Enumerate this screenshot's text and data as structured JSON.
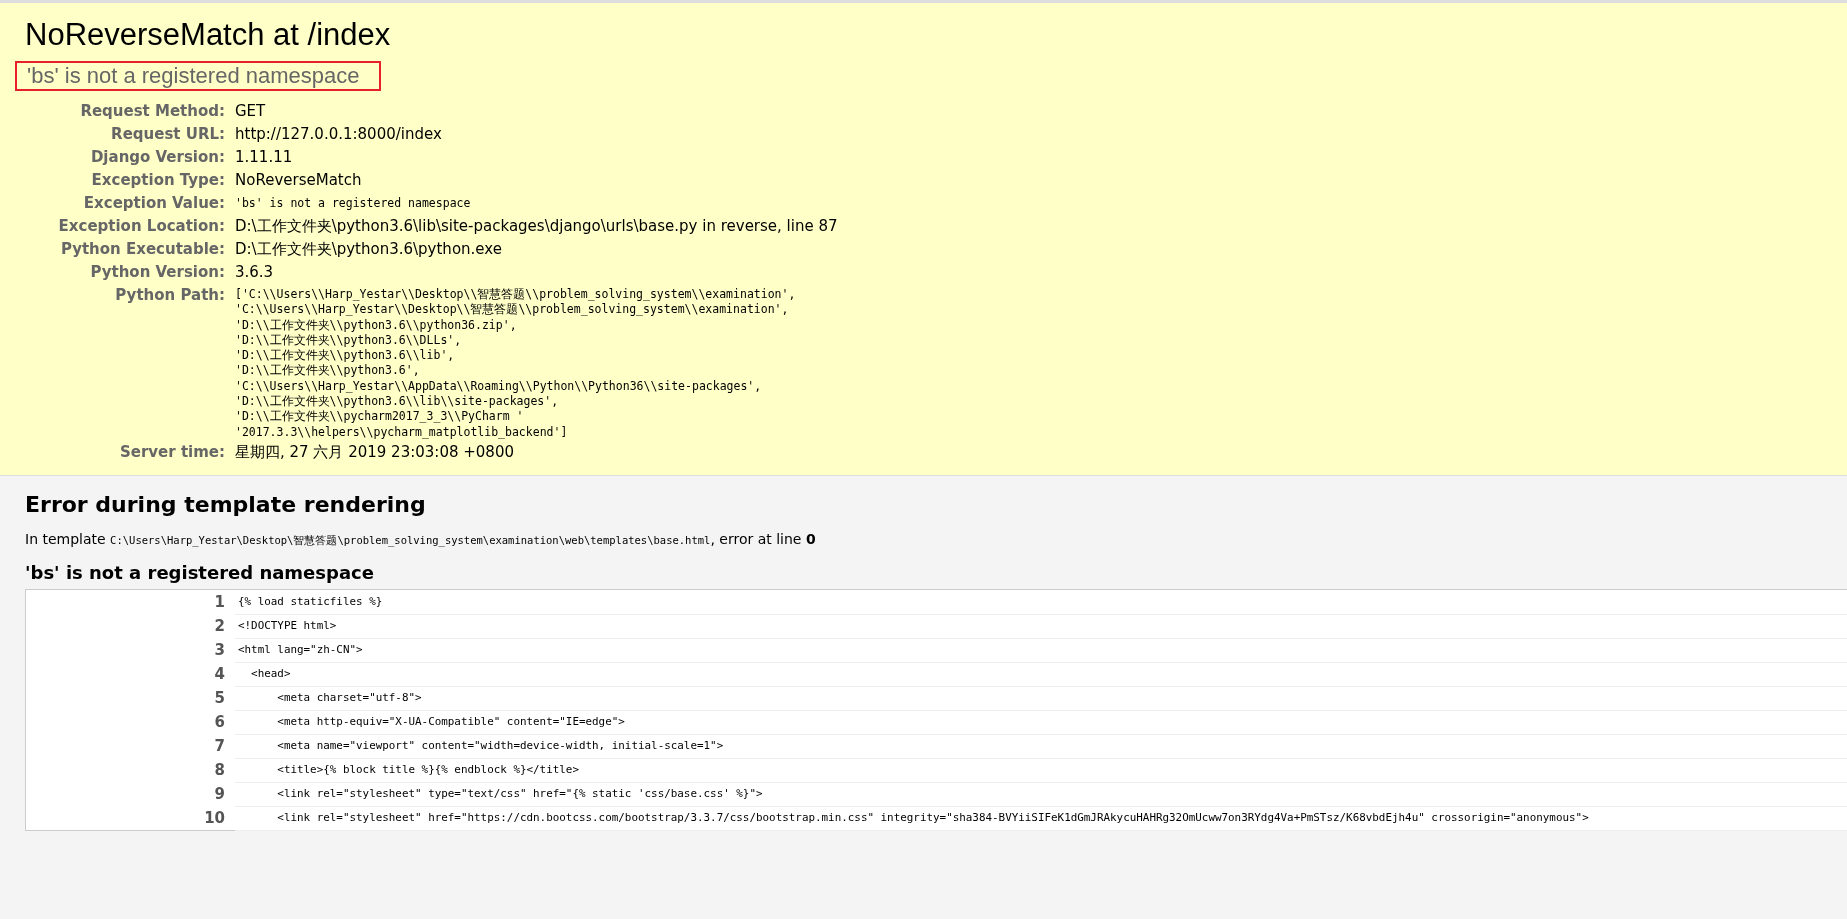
{
  "summary": {
    "title": "NoReverseMatch at /index",
    "subtitle": {
      "text": "'bs' is not a registered namespace",
      "highlighted": true
    },
    "meta": [
      {
        "label": "Request Method:",
        "kind": "text",
        "value": "GET"
      },
      {
        "label": "Request URL:",
        "kind": "text",
        "value": "http://127.0.0.1:8000/index"
      },
      {
        "label": "Django Version:",
        "kind": "text",
        "value": "1.11.11"
      },
      {
        "label": "Exception Type:",
        "kind": "text",
        "value": "NoReverseMatch"
      },
      {
        "label": "Exception Value:",
        "kind": "code",
        "value": "'bs' is not a registered namespace"
      },
      {
        "label": "Exception Location:",
        "kind": "text",
        "value": "D:\\工作文件夹\\python3.6\\lib\\site-packages\\django\\urls\\base.py in reverse, line 87"
      },
      {
        "label": "Python Executable:",
        "kind": "text",
        "value": "D:\\工作文件夹\\python3.6\\python.exe"
      },
      {
        "label": "Python Version:",
        "kind": "text",
        "value": "3.6.3"
      },
      {
        "label": "Python Path:",
        "kind": "lines",
        "lines": [
          "['C:\\\\Users\\\\Harp_Yestar\\\\Desktop\\\\智慧答题\\\\problem_solving_system\\\\examination',",
          "'C:\\\\Users\\\\Harp_Yestar\\\\Desktop\\\\智慧答题\\\\problem_solving_system\\\\examination',",
          "'D:\\\\工作文件夹\\\\python3.6\\\\python36.zip',",
          "'D:\\\\工作文件夹\\\\python3.6\\\\DLLs',",
          "'D:\\\\工作文件夹\\\\python3.6\\\\lib',",
          "'D:\\\\工作文件夹\\\\python3.6',",
          "'C:\\\\Users\\\\Harp_Yestar\\\\AppData\\\\Roaming\\\\Python\\\\Python36\\\\site-packages',",
          "'D:\\\\工作文件夹\\\\python3.6\\\\lib\\\\site-packages',",
          "'D:\\\\工作文件夹\\\\pycharm2017_3_3\\\\PyCharm '",
          "'2017.3.3\\\\helpers\\\\pycharm_matplotlib_backend']"
        ]
      },
      {
        "label": "Server time:",
        "kind": "text",
        "value": "星期四, 27 六月 2019 23:03:08 +0800"
      }
    ]
  },
  "template": {
    "heading": "Error during template rendering",
    "intro": {
      "before": "In template ",
      "path": "C:\\Users\\Harp_Yestar\\Desktop\\智慧答题\\problem_solving_system\\examination\\web\\templates\\base.html",
      "after": ", error at line ",
      "line": "0"
    },
    "error": "'bs' is not a registered namespace",
    "rows": [
      {
        "number": "1",
        "code": "{% load staticfiles %}"
      },
      {
        "number": "2",
        "code": "<!DOCTYPE html>"
      },
      {
        "number": "3",
        "code": "<html lang=\"zh-CN\">"
      },
      {
        "number": "4",
        "code": "  <head>"
      },
      {
        "number": "5",
        "code": "      <meta charset=\"utf-8\">"
      },
      {
        "number": "6",
        "code": "      <meta http-equiv=\"X-UA-Compatible\" content=\"IE=edge\">"
      },
      {
        "number": "7",
        "code": "      <meta name=\"viewport\" content=\"width=device-width, initial-scale=1\">"
      },
      {
        "number": "8",
        "code": "      <title>{% block title %}{% endblock %}</title>"
      },
      {
        "number": "9",
        "code": "      <link rel=\"stylesheet\" type=\"text/css\" href=\"{% static 'css/base.css' %}\">"
      },
      {
        "number": "10",
        "code": "      <link rel=\"stylesheet\" href=\"https://cdn.bootcss.com/bootstrap/3.3.7/css/bootstrap.min.css\" integrity=\"sha384-BVYiiSIFeK1dGmJRAkycuHAHRg32OmUcww7on3RYdg4Va+PmSTsz/K68vbdEjh4u\" crossorigin=\"anonymous\">"
      }
    ]
  }
}
